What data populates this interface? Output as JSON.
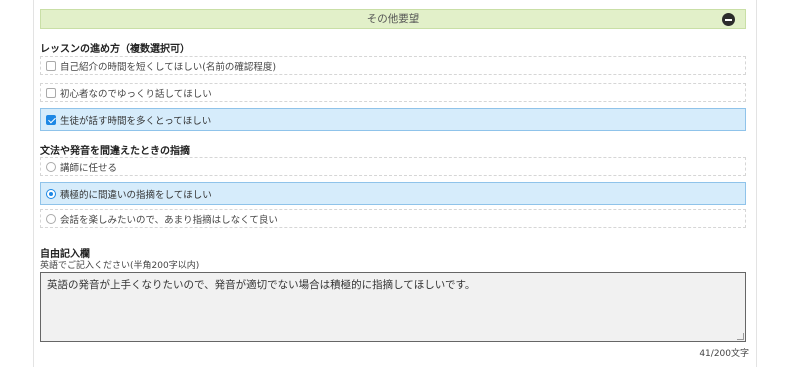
{
  "section": {
    "title": "その他要望",
    "collapse_icon": "minus-circle-icon"
  },
  "lesson_style": {
    "title": "レッスンの進め方（複数選択可）",
    "options": [
      {
        "label": "自己紹介の時間を短くしてほしい(名前の確認程度)",
        "checked": false
      },
      {
        "label": "初心者なのでゆっくり話してほしい",
        "checked": false
      },
      {
        "label": "生徒が話す時間を多くとってほしい",
        "checked": true
      }
    ]
  },
  "correction": {
    "title": "文法や発音を間違えたときの指摘",
    "options": [
      {
        "label": "講師に任せる",
        "selected": false
      },
      {
        "label": "積極的に間違いの指摘をしてほしい",
        "selected": true
      },
      {
        "label": "会話を楽しみたいので、あまり指摘はしなくて良い",
        "selected": false
      }
    ]
  },
  "free_entry": {
    "title": "自由記入欄",
    "hint": "英語でご記入ください(半角200字以内)",
    "value": "英語の発音が上手くなりたいので、発音が適切でない場合は積極的に指摘してほしいです。",
    "counter": "41/200文字"
  },
  "colors": {
    "header_bg": "#e2f0c9",
    "selected_bg": "#d6ecfb",
    "accent": "#1e88e5"
  }
}
